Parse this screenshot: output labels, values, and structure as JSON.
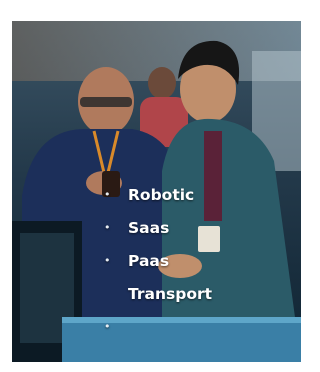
{
  "hero": {
    "image_description_icon": "photo-two-men-looking-at-phone",
    "list_items": [
      {
        "bullet": "•",
        "label": "Robotic"
      },
      {
        "bullet": "•",
        "label": "Saas"
      },
      {
        "bullet": "•",
        "label": "Paas"
      },
      {
        "bullet": "",
        "label": "Transport"
      },
      {
        "bullet": "•",
        "label": ""
      }
    ]
  },
  "colors": {
    "text": "#ffffff",
    "background_dark": "#1e3a4c"
  }
}
